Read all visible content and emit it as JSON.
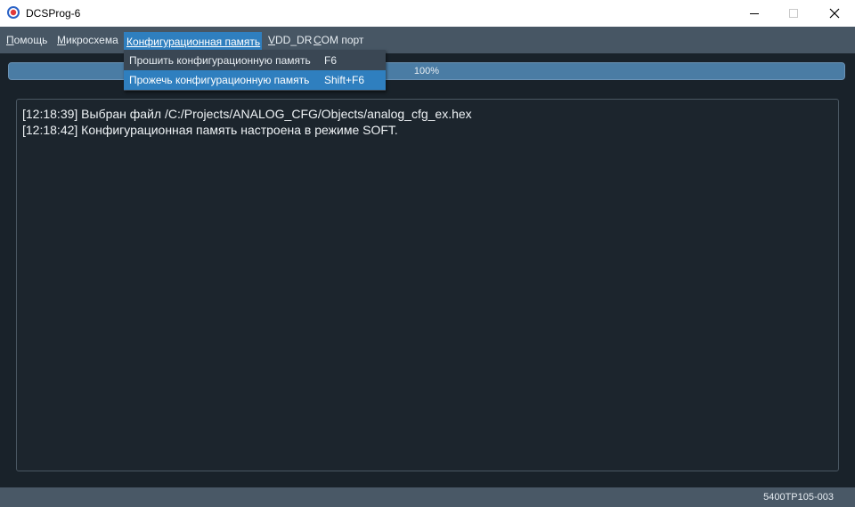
{
  "window": {
    "title": "DCSProg-6",
    "icon": "app-logo-icon",
    "controls": [
      "minimize-icon",
      "maximize-icon",
      "close-icon"
    ]
  },
  "menubar": {
    "items": [
      {
        "label": "Помощь",
        "accel": "П",
        "rest": "омощь"
      },
      {
        "label": "Микросхема",
        "accel": "М",
        "rest": "икросхема"
      },
      {
        "label": "Конфигурационная память",
        "accel": "К",
        "rest": "онфигурационная память",
        "active": true
      },
      {
        "label": "VDD_DR",
        "accel": "V",
        "rest": "DD_DR"
      },
      {
        "label": "COM порт",
        "accel": "C",
        "rest": "OM порт"
      }
    ]
  },
  "dropdown": {
    "items": [
      {
        "label": "Прошить конфигурационную память",
        "shortcut": "F6"
      },
      {
        "label": "Прожечь конфигурационную память",
        "shortcut": "Shift+F6",
        "highlighted": true
      }
    ]
  },
  "progress": {
    "value": 100,
    "text": "100%"
  },
  "log": {
    "lines": [
      "[12:18:39] Выбран файл /C:/Projects/ANALOG_CFG/Objects/analog_cfg_ex.hex",
      "[12:18:42] Конфигурационная память настроена в режиме SOFT."
    ]
  },
  "status": {
    "device": "5400TP105-003"
  },
  "colors": {
    "accent": "#2f7fbf",
    "background": "#19222a",
    "menubar": "#475664"
  }
}
